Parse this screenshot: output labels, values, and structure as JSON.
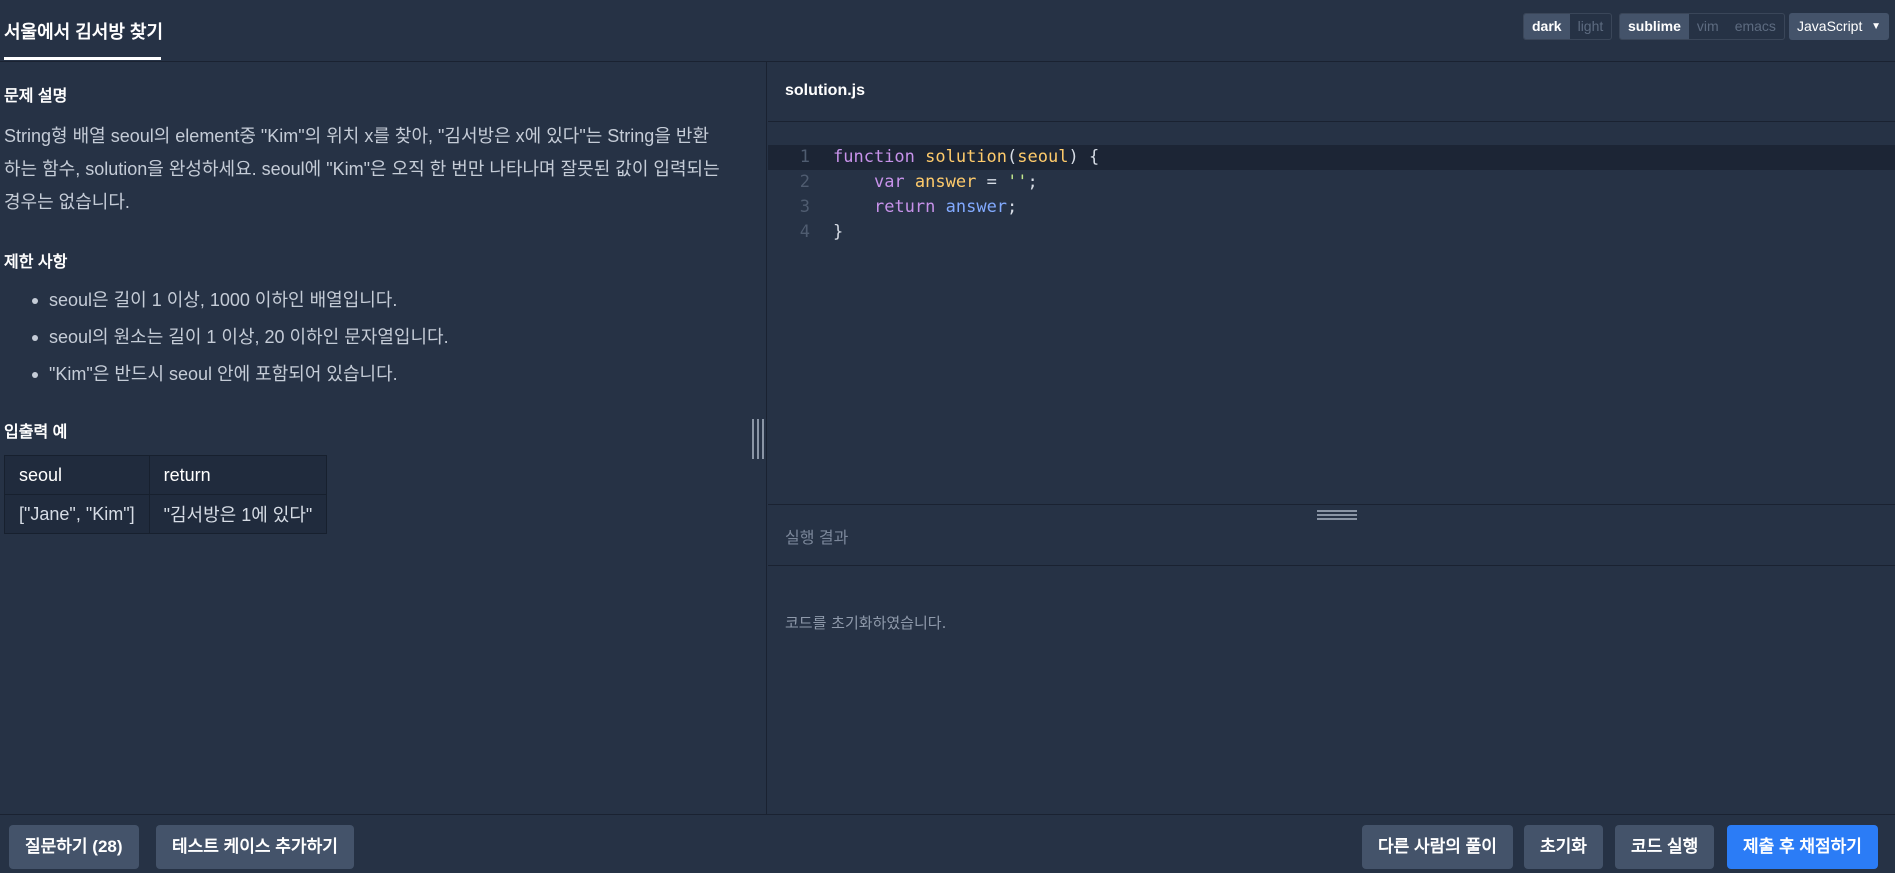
{
  "header": {
    "title": "서울에서 김서방 찾기",
    "theme": {
      "options": [
        "dark",
        "light"
      ],
      "selected": "dark"
    },
    "keymap": {
      "options": [
        "sublime",
        "vim",
        "emacs"
      ],
      "selected": "sublime"
    },
    "language": "JavaScript"
  },
  "problem": {
    "description_title": "문제 설명",
    "description": "String형 배열 seoul의 element중 \"Kim\"의 위치 x를 찾아, \"김서방은 x에 있다\"는 String을 반환하는 함수, solution을 완성하세요. seoul에 \"Kim\"은 오직 한 번만 나타나며 잘못된 값이 입력되는 경우는 없습니다.",
    "constraints_title": "제한 사항",
    "constraints": [
      "seoul은 길이 1 이상, 1000 이하인 배열입니다.",
      "seoul의 원소는 길이 1 이상, 20 이하인 문자열입니다.",
      "\"Kim\"은 반드시 seoul 안에 포함되어 있습니다."
    ],
    "examples_title": "입출력 예",
    "examples": {
      "headers": [
        "seoul",
        "return"
      ],
      "rows": [
        [
          "[\"Jane\", \"Kim\"]",
          "\"김서방은 1에 있다\""
        ]
      ]
    }
  },
  "editor": {
    "filename": "solution.js",
    "line_numbers": [
      "1",
      "2",
      "3",
      "4"
    ]
  },
  "result": {
    "title": "실행 결과",
    "message": "코드를 초기화하였습니다."
  },
  "footer": {
    "ask_button": "질문하기 (28)",
    "add_testcase_button": "테스트 케이스 추가하기",
    "others_solutions_button": "다른 사람의 풀이",
    "reset_button": "초기화",
    "run_button": "코드 실행",
    "submit_button": "제출 후 채점하기"
  },
  "colors": {
    "background": "#263245",
    "button": "#44536a",
    "primary": "#2b7cf6",
    "keyword": "#c792ea",
    "function": "#ffcb6b",
    "string": "#c3e88d"
  }
}
